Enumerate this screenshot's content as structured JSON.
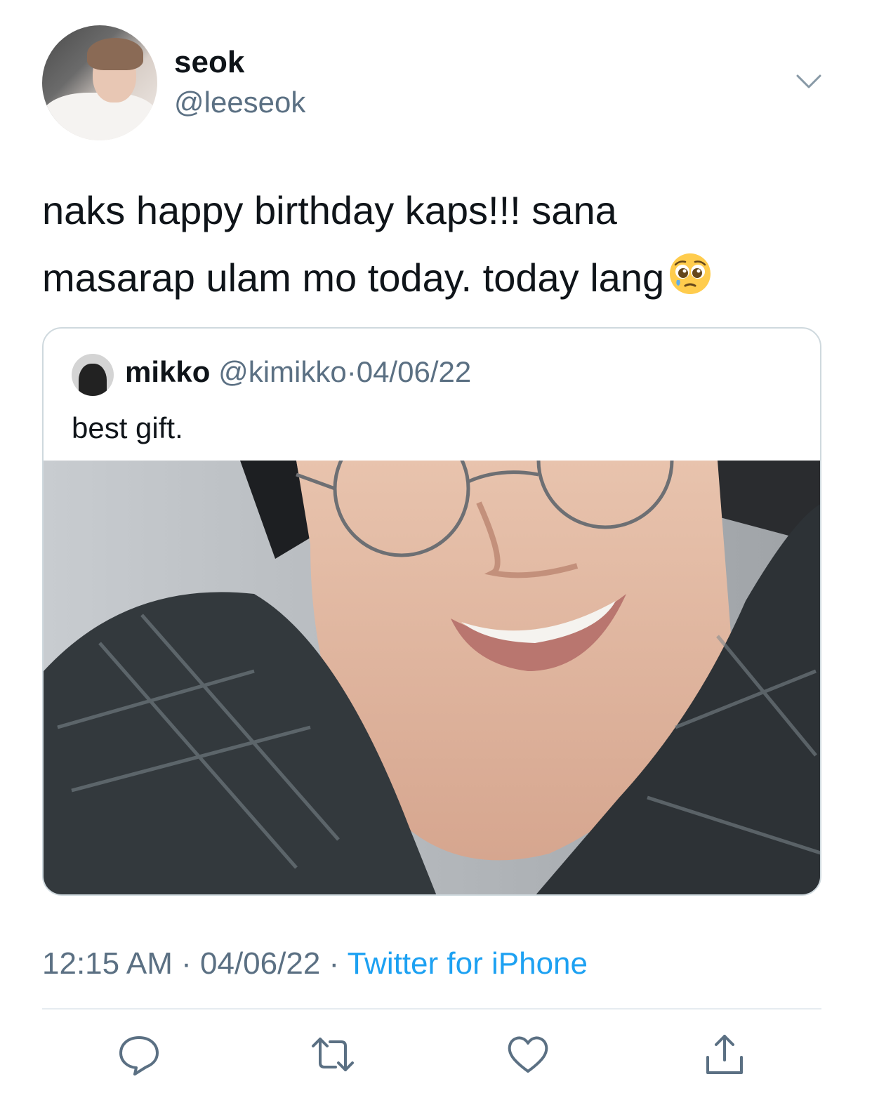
{
  "tweet": {
    "author_name": "seok",
    "author_handle": "@leeseok",
    "text_line1": "naks happy birthday kaps!!! sana",
    "text_line2": "masarap ulam mo today. today lang",
    "emoji_name": "pleading-face-emoji"
  },
  "quoted": {
    "author_name": "mikko",
    "author_handle": "@kimikko",
    "separator": "·",
    "date": "04/06/22",
    "text": "best gift."
  },
  "meta": {
    "time": "12:15 AM",
    "separator": " · ",
    "date": "04/06/22",
    "source": "Twitter for iPhone"
  },
  "colors": {
    "text_primary": "#0f1419",
    "text_secondary": "#5b7083",
    "link": "#1da1f2",
    "border": "#cfd9de"
  },
  "icons": {
    "menu": "chevron-down-icon",
    "reply": "reply-icon",
    "retweet": "retweet-icon",
    "like": "heart-icon",
    "share": "share-icon"
  }
}
